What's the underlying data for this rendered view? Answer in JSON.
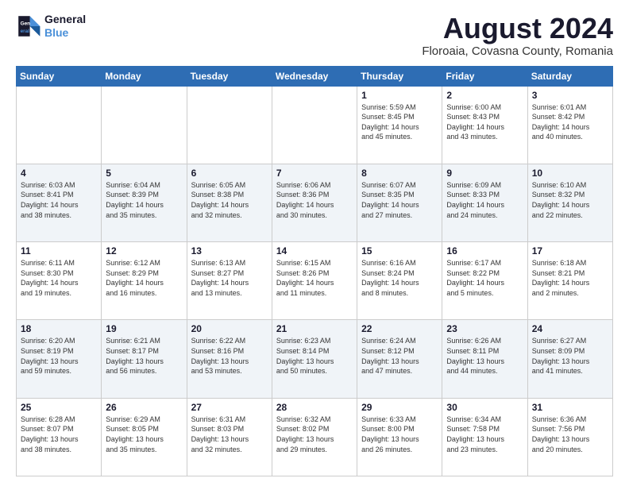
{
  "logo": {
    "line1": "General",
    "line2": "Blue"
  },
  "title": "August 2024",
  "subtitle": "Floroaia, Covasna County, Romania",
  "weekdays": [
    "Sunday",
    "Monday",
    "Tuesday",
    "Wednesday",
    "Thursday",
    "Friday",
    "Saturday"
  ],
  "weeks": [
    [
      {
        "day": "",
        "info": ""
      },
      {
        "day": "",
        "info": ""
      },
      {
        "day": "",
        "info": ""
      },
      {
        "day": "",
        "info": ""
      },
      {
        "day": "1",
        "info": "Sunrise: 5:59 AM\nSunset: 8:45 PM\nDaylight: 14 hours\nand 45 minutes."
      },
      {
        "day": "2",
        "info": "Sunrise: 6:00 AM\nSunset: 8:43 PM\nDaylight: 14 hours\nand 43 minutes."
      },
      {
        "day": "3",
        "info": "Sunrise: 6:01 AM\nSunset: 8:42 PM\nDaylight: 14 hours\nand 40 minutes."
      }
    ],
    [
      {
        "day": "4",
        "info": "Sunrise: 6:03 AM\nSunset: 8:41 PM\nDaylight: 14 hours\nand 38 minutes."
      },
      {
        "day": "5",
        "info": "Sunrise: 6:04 AM\nSunset: 8:39 PM\nDaylight: 14 hours\nand 35 minutes."
      },
      {
        "day": "6",
        "info": "Sunrise: 6:05 AM\nSunset: 8:38 PM\nDaylight: 14 hours\nand 32 minutes."
      },
      {
        "day": "7",
        "info": "Sunrise: 6:06 AM\nSunset: 8:36 PM\nDaylight: 14 hours\nand 30 minutes."
      },
      {
        "day": "8",
        "info": "Sunrise: 6:07 AM\nSunset: 8:35 PM\nDaylight: 14 hours\nand 27 minutes."
      },
      {
        "day": "9",
        "info": "Sunrise: 6:09 AM\nSunset: 8:33 PM\nDaylight: 14 hours\nand 24 minutes."
      },
      {
        "day": "10",
        "info": "Sunrise: 6:10 AM\nSunset: 8:32 PM\nDaylight: 14 hours\nand 22 minutes."
      }
    ],
    [
      {
        "day": "11",
        "info": "Sunrise: 6:11 AM\nSunset: 8:30 PM\nDaylight: 14 hours\nand 19 minutes."
      },
      {
        "day": "12",
        "info": "Sunrise: 6:12 AM\nSunset: 8:29 PM\nDaylight: 14 hours\nand 16 minutes."
      },
      {
        "day": "13",
        "info": "Sunrise: 6:13 AM\nSunset: 8:27 PM\nDaylight: 14 hours\nand 13 minutes."
      },
      {
        "day": "14",
        "info": "Sunrise: 6:15 AM\nSunset: 8:26 PM\nDaylight: 14 hours\nand 11 minutes."
      },
      {
        "day": "15",
        "info": "Sunrise: 6:16 AM\nSunset: 8:24 PM\nDaylight: 14 hours\nand 8 minutes."
      },
      {
        "day": "16",
        "info": "Sunrise: 6:17 AM\nSunset: 8:22 PM\nDaylight: 14 hours\nand 5 minutes."
      },
      {
        "day": "17",
        "info": "Sunrise: 6:18 AM\nSunset: 8:21 PM\nDaylight: 14 hours\nand 2 minutes."
      }
    ],
    [
      {
        "day": "18",
        "info": "Sunrise: 6:20 AM\nSunset: 8:19 PM\nDaylight: 13 hours\nand 59 minutes."
      },
      {
        "day": "19",
        "info": "Sunrise: 6:21 AM\nSunset: 8:17 PM\nDaylight: 13 hours\nand 56 minutes."
      },
      {
        "day": "20",
        "info": "Sunrise: 6:22 AM\nSunset: 8:16 PM\nDaylight: 13 hours\nand 53 minutes."
      },
      {
        "day": "21",
        "info": "Sunrise: 6:23 AM\nSunset: 8:14 PM\nDaylight: 13 hours\nand 50 minutes."
      },
      {
        "day": "22",
        "info": "Sunrise: 6:24 AM\nSunset: 8:12 PM\nDaylight: 13 hours\nand 47 minutes."
      },
      {
        "day": "23",
        "info": "Sunrise: 6:26 AM\nSunset: 8:11 PM\nDaylight: 13 hours\nand 44 minutes."
      },
      {
        "day": "24",
        "info": "Sunrise: 6:27 AM\nSunset: 8:09 PM\nDaylight: 13 hours\nand 41 minutes."
      }
    ],
    [
      {
        "day": "25",
        "info": "Sunrise: 6:28 AM\nSunset: 8:07 PM\nDaylight: 13 hours\nand 38 minutes."
      },
      {
        "day": "26",
        "info": "Sunrise: 6:29 AM\nSunset: 8:05 PM\nDaylight: 13 hours\nand 35 minutes."
      },
      {
        "day": "27",
        "info": "Sunrise: 6:31 AM\nSunset: 8:03 PM\nDaylight: 13 hours\nand 32 minutes."
      },
      {
        "day": "28",
        "info": "Sunrise: 6:32 AM\nSunset: 8:02 PM\nDaylight: 13 hours\nand 29 minutes."
      },
      {
        "day": "29",
        "info": "Sunrise: 6:33 AM\nSunset: 8:00 PM\nDaylight: 13 hours\nand 26 minutes."
      },
      {
        "day": "30",
        "info": "Sunrise: 6:34 AM\nSunset: 7:58 PM\nDaylight: 13 hours\nand 23 minutes."
      },
      {
        "day": "31",
        "info": "Sunrise: 6:36 AM\nSunset: 7:56 PM\nDaylight: 13 hours\nand 20 minutes."
      }
    ]
  ]
}
